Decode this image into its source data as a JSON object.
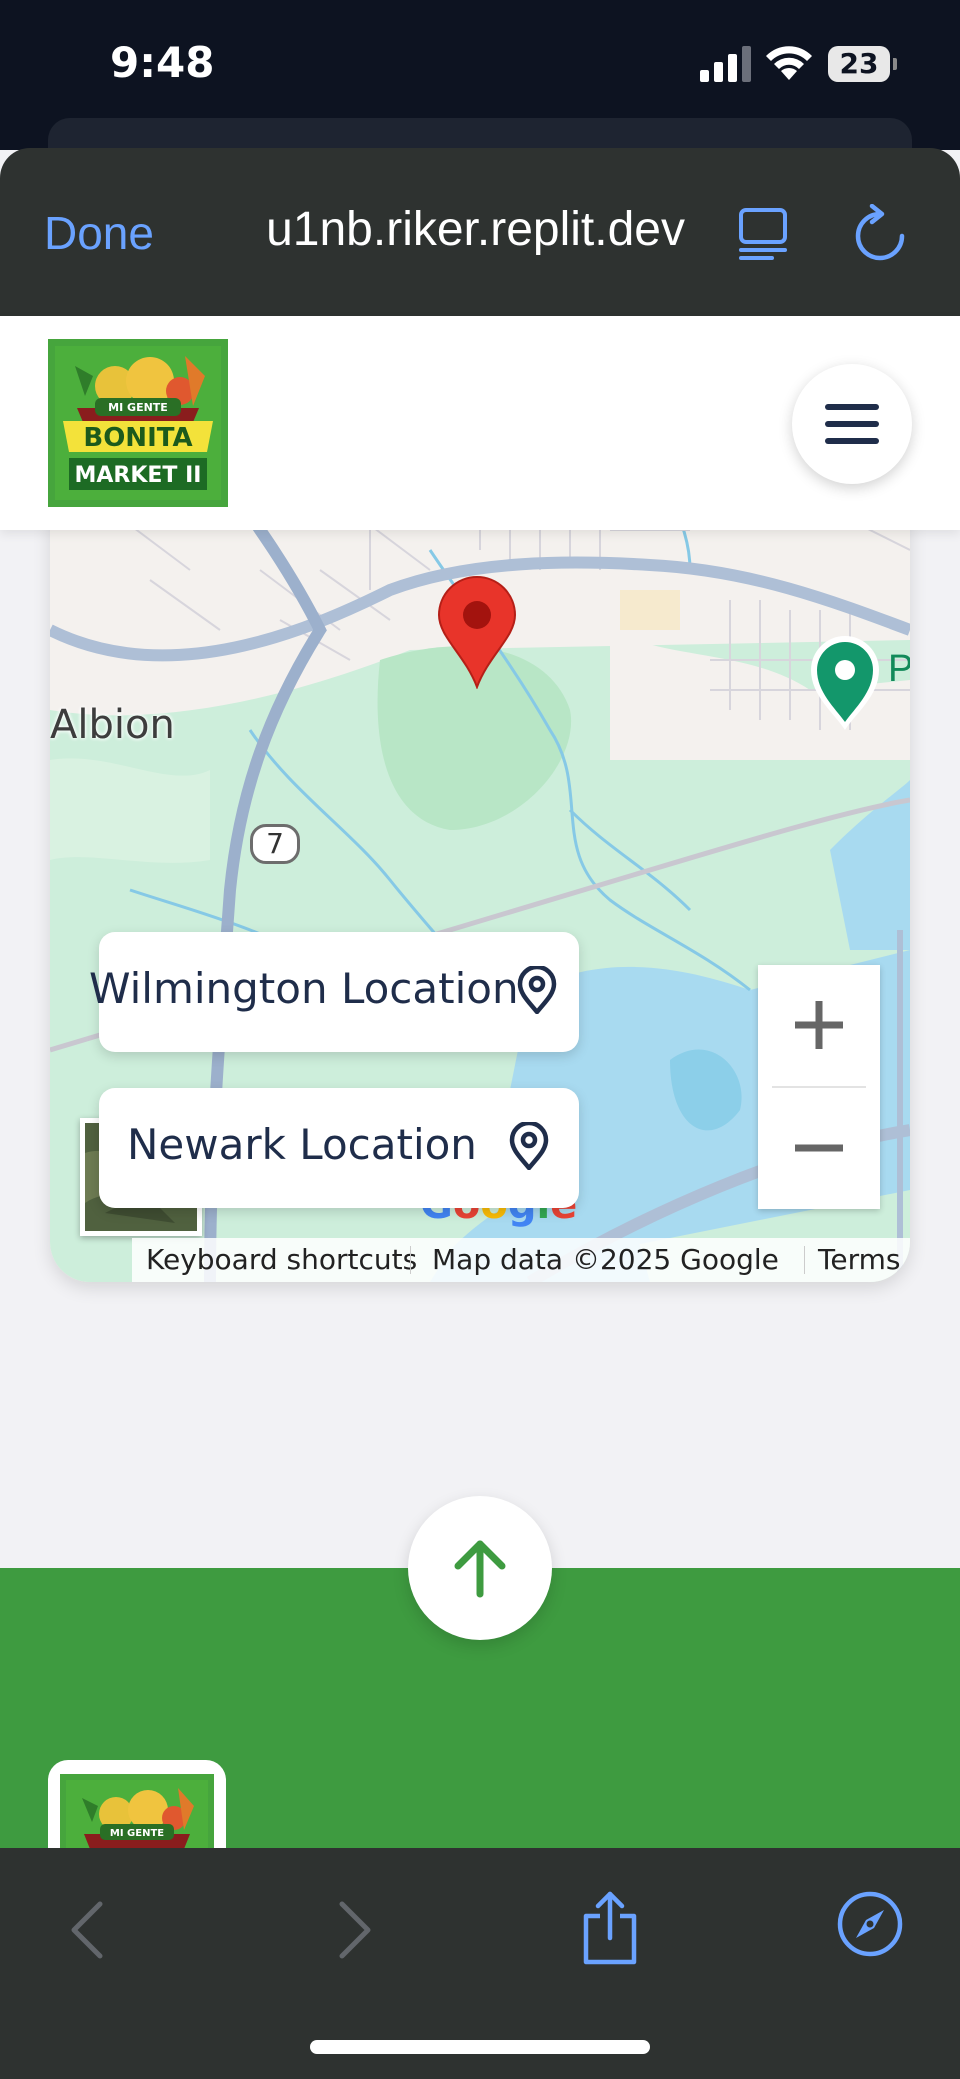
{
  "status_bar": {
    "time": "9:48",
    "battery": "23"
  },
  "browser": {
    "done_label": "Done",
    "url": "u1nb.riker.replit.dev"
  },
  "site": {
    "logo_text_top": "MI GENTE",
    "logo_text_mid": "BONITA",
    "logo_text_bottom": "MARKET II",
    "brand_color": "#3e9b40",
    "accent_color": "#1f2d4a"
  },
  "map": {
    "town_label": "Albion",
    "route_number": "7",
    "poi_label_partial": "P",
    "locations": [
      {
        "label": "Wilmington Location"
      },
      {
        "label": "Newark Location"
      }
    ],
    "zoom_in": "+",
    "zoom_out": "−",
    "attribution": {
      "shortcuts": "Keyboard shortcuts",
      "map_data": "Map data ©2025 Google",
      "terms": "Terms"
    }
  }
}
